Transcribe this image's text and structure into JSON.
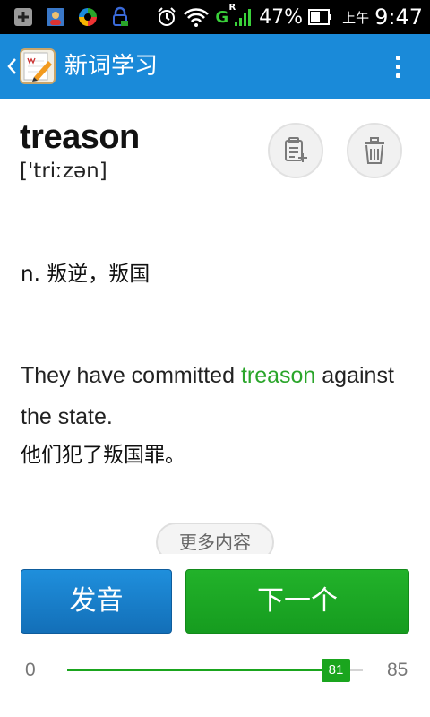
{
  "status_bar": {
    "battery_percent": "47%",
    "time_prefix": "上午",
    "time": "9:47",
    "network_label": "G",
    "roaming_label": "R"
  },
  "app_bar": {
    "title": "新词学习",
    "color": "#1a8ad9"
  },
  "word_card": {
    "word": "treason",
    "phonetic": "['triːzən]",
    "definition": "n. 叛逆，叛国",
    "example_before": "They have committed ",
    "example_highlight": "treason",
    "example_after": " against the state.",
    "example_translation": "他们犯了叛国罪。",
    "highlight_color": "#2aa52a",
    "more_label": "更多内容"
  },
  "actions": {
    "speak_label": "发音",
    "next_label": "下一个"
  },
  "progress": {
    "min": "0",
    "max": "85",
    "current": "81",
    "current_value": 81,
    "max_value": 85
  }
}
